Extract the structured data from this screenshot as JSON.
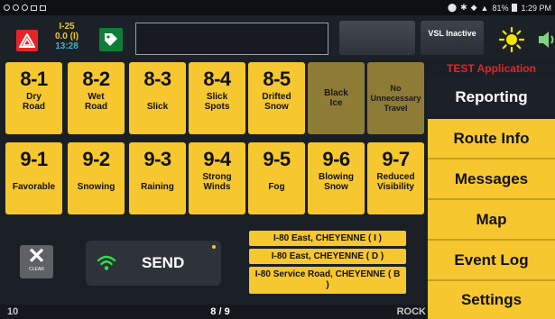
{
  "status_bar": {
    "time": "1:29 PM",
    "battery": "81%"
  },
  "header": {
    "route": "I-25",
    "milepost": "0.0 (I)",
    "clock": "13:28",
    "vsl_label": "VSL Inactive",
    "icons": {
      "hazard": "hazard-triangle-icon",
      "tag": "tag-icon",
      "sun": "sun-icon",
      "speaker": "speaker-icon"
    }
  },
  "tiles_row1": [
    {
      "num": "8-1",
      "label": "Dry Road"
    },
    {
      "num": "8-2",
      "label": "Wet Road"
    },
    {
      "num": "8-3",
      "label": "Slick"
    },
    {
      "num": "8-4",
      "label": "Slick Spots"
    },
    {
      "num": "8-5",
      "label": "Drifted Snow"
    }
  ],
  "tiles_row1_dark": [
    {
      "label": "Black Ice"
    },
    {
      "label": "No Unnecessary Travel"
    }
  ],
  "tiles_row2": [
    {
      "num": "9-1",
      "label": "Favorable"
    },
    {
      "num": "9-2",
      "label": "Snowing"
    },
    {
      "num": "9-3",
      "label": "Raining"
    },
    {
      "num": "9-4",
      "label": "Strong Winds"
    },
    {
      "num": "9-5",
      "label": "Fog"
    },
    {
      "num": "9-6",
      "label": "Blowing Snow"
    },
    {
      "num": "9-7",
      "label": "Reduced Visibility"
    }
  ],
  "app": {
    "test_label": "TEST Application"
  },
  "menu": [
    {
      "label": "Reporting",
      "active": true
    },
    {
      "label": "Route Info",
      "active": false
    },
    {
      "label": "Messages",
      "active": false
    },
    {
      "label": "Map",
      "active": false
    },
    {
      "label": "Event Log",
      "active": false
    },
    {
      "label": "Settings",
      "active": false
    }
  ],
  "controls": {
    "clear_label": "CLEAR",
    "send_label": "SEND",
    "locations": [
      "I-80 East, CHEYENNE ( I )",
      "I-80 East, CHEYENNE ( D )",
      "I-80 Service Road, CHEYENNE ( B )"
    ]
  },
  "bottom_bar": {
    "left": "10",
    "page": "8 / 9",
    "right": "ROCK"
  },
  "colors": {
    "accent_yellow": "#f6c72e",
    "dark_tile": "#8e7b36",
    "hazard_red": "#e5242a",
    "tag_green": "#0e7d3a",
    "background": "#1a1f26"
  }
}
